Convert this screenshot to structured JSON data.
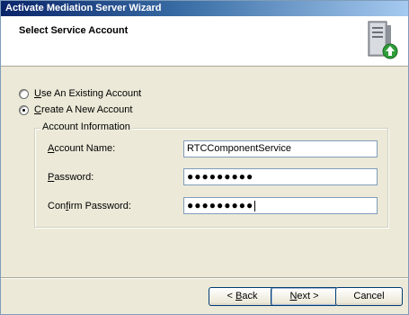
{
  "window": {
    "title": "Activate Mediation Server Wizard"
  },
  "header": {
    "title": "Select Service Account"
  },
  "options": {
    "existing": {
      "accel": "U",
      "label": "se An Existing Account",
      "checked": false
    },
    "new": {
      "accel": "C",
      "label": "reate A New Account",
      "checked": true
    }
  },
  "group": {
    "legend": "Account Information",
    "account_name": {
      "accel": "A",
      "label": "ccount Name:",
      "value": "RTCComponentService"
    },
    "password": {
      "accel": "P",
      "label": "assword:",
      "value": "●●●●●●●●●"
    },
    "confirm_password": {
      "pre": "Con",
      "accel": "f",
      "label": "irm Password:",
      "value": "●●●●●●●●●"
    }
  },
  "buttons": {
    "back": {
      "prefix": "< ",
      "accel": "B",
      "label": "ack"
    },
    "next": {
      "accel": "N",
      "label": "ext >"
    },
    "cancel": {
      "label": "Cancel"
    }
  },
  "icons": {
    "server": "server-upgrade-icon"
  }
}
